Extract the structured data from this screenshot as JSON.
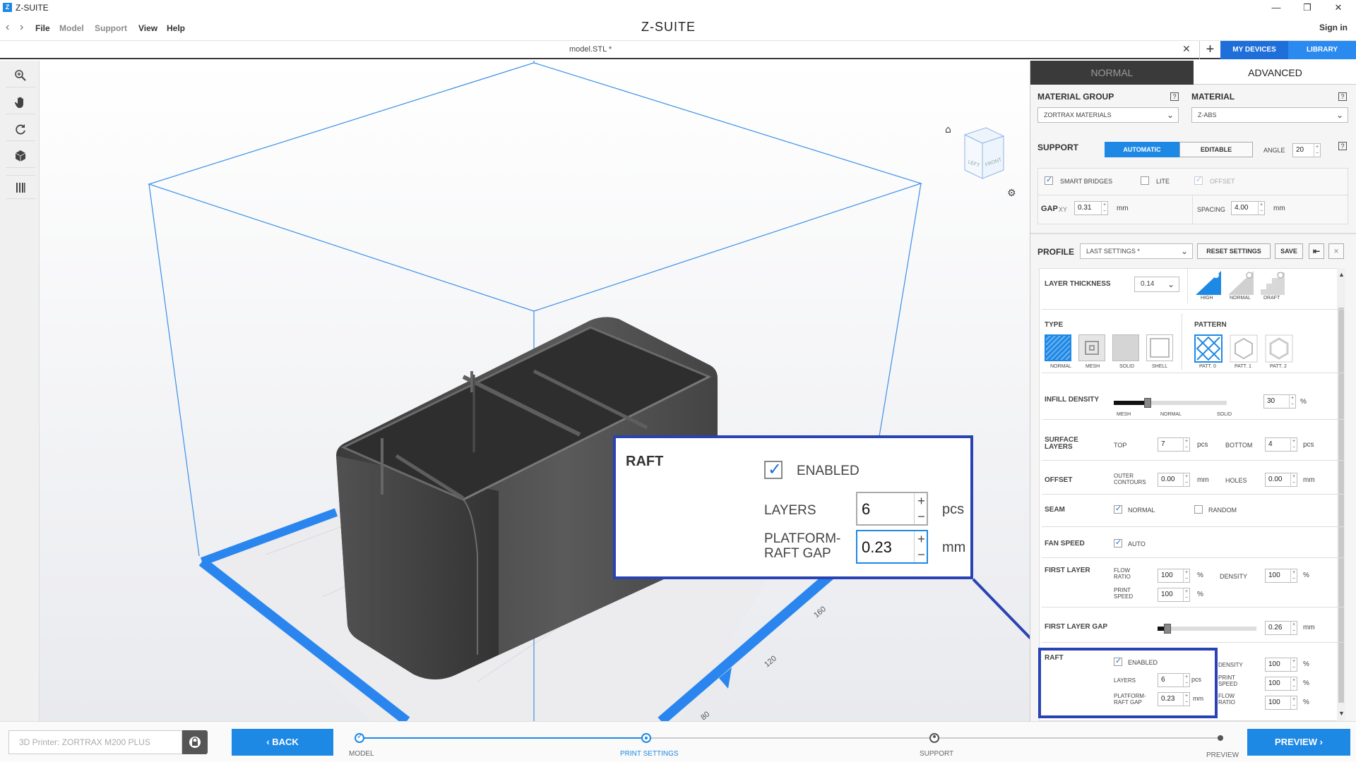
{
  "window": {
    "app_title": "Z-SUITE",
    "logo_letter": "Z",
    "minimize": "—",
    "restore": "❐",
    "close": "✕"
  },
  "menu": {
    "back": "‹",
    "forward": "›",
    "items": [
      "File",
      "Model",
      "Support",
      "View",
      "Help"
    ],
    "brand": "Z-SUITE",
    "sign_in": "Sign in"
  },
  "tabs": {
    "doc_title": "model.STL *",
    "close": "✕",
    "plus": "+",
    "my_devices": "MY DEVICES",
    "library": "LIBRARY"
  },
  "mode_tabs": {
    "normal": "NORMAL",
    "advanced": "ADVANCED",
    "active": "ADVANCED"
  },
  "material": {
    "group_label": "MATERIAL GROUP",
    "group_value": "ZORTRAX MATERIALS",
    "material_label": "MATERIAL",
    "material_value": "Z-ABS",
    "help": "?"
  },
  "support": {
    "label": "SUPPORT",
    "automatic": "AUTOMATIC",
    "editable": "EDITABLE",
    "angle_label": "ANGLE",
    "angle_value": "20",
    "smart_bridges": "SMART BRIDGES",
    "lite": "LITE",
    "offset": "OFFSET",
    "gap_label": "GAP",
    "gap_xy": "XY",
    "gap_value": "0.31",
    "gap_unit": "mm",
    "spacing_label": "SPACING",
    "spacing_value": "4.00",
    "spacing_unit": "mm"
  },
  "profile": {
    "label": "PROFILE",
    "value": "LAST SETTINGS *",
    "reset": "RESET SETTINGS",
    "save": "SAVE",
    "import_icon": "⇤",
    "delete_icon": "✕"
  },
  "layer_thickness": {
    "label": "LAYER THICKNESS",
    "value": "0.14",
    "modes": [
      "HIGH",
      "NORMAL",
      "DRAFT"
    ]
  },
  "infill": {
    "type_label": "TYPE",
    "types": [
      "NORMAL",
      "MESH",
      "SOLID",
      "SHELL"
    ],
    "pattern_label": "PATTERN",
    "patterns": [
      "PATT. 0",
      "PATT. 1",
      "PATT. 2"
    ],
    "density_label": "INFILL DENSITY",
    "density_value": "30",
    "density_unit": "%",
    "density_level": 0.3,
    "density_ticks": [
      "MESH",
      "NORMAL",
      "SOLID"
    ]
  },
  "surface_layers": {
    "label1": "SURFACE",
    "label2": "LAYERS",
    "top": "TOP",
    "top_value": "7",
    "bottom": "BOTTOM",
    "bottom_value": "4",
    "unit": "pcs"
  },
  "offset": {
    "label": "OFFSET",
    "outer1": "OUTER",
    "outer2": "CONTOURS",
    "outer_value": "0.00",
    "holes": "HOLES",
    "holes_value": "0.00",
    "unit": "mm"
  },
  "seam": {
    "label": "SEAM",
    "normal": "NORMAL",
    "random": "RANDOM"
  },
  "fan": {
    "label": "FAN SPEED",
    "auto": "AUTO"
  },
  "first_layer": {
    "label": "FIRST LAYER",
    "flow1": "FLOW",
    "flow2": "RATIO",
    "flow_value": "100",
    "density": "DENSITY",
    "density_value": "100",
    "print1": "PRINT",
    "print2": "SPEED",
    "print_value": "100",
    "unit": "%"
  },
  "first_layer_gap": {
    "label": "FIRST LAYER GAP",
    "value": "0.26",
    "unit": "mm",
    "level": 0.1
  },
  "raft": {
    "label": "RAFT",
    "enabled": "ENABLED",
    "layers": "LAYERS",
    "layers_value": "6",
    "layers_unit": "pcs",
    "gap1": "PLATFORM-",
    "gap2": "RAFT GAP",
    "gap_value": "0.23",
    "gap_unit": "mm",
    "density": "DENSITY",
    "density_value": "100",
    "print1": "PRINT",
    "print2": "SPEED",
    "print_value": "100",
    "flow1": "FLOW",
    "flow2": "RATIO",
    "flow_value": "100",
    "pct": "%"
  },
  "viewcube": {
    "left": "LEFT",
    "front": "FRONT",
    "home": "⌂",
    "gear": "⚙"
  },
  "axis": {
    "t160": "160",
    "t120": "120",
    "t80": "80"
  },
  "bottom": {
    "printer": "3D Printer: ZORTRAX M200 PLUS",
    "back": "‹ BACK",
    "preview": "PREVIEW ›",
    "steps": [
      "MODEL",
      "PRINT SETTINGS",
      "SUPPORT",
      "PREVIEW"
    ]
  },
  "colors": {
    "accent": "#1e88e5",
    "callout": "#2a43b4",
    "dark_tab": "#3a3a3a"
  }
}
